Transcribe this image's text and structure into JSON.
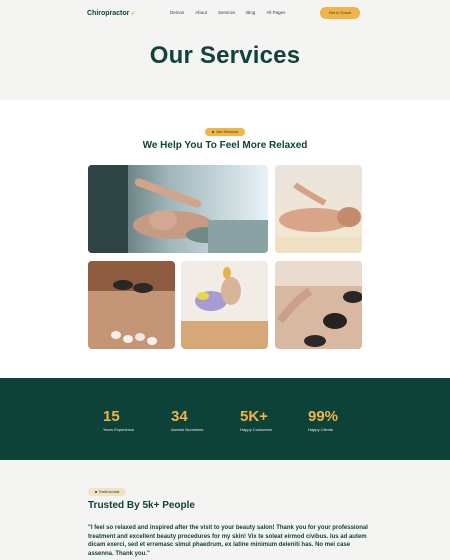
{
  "header": {
    "logo": "Chiropractor",
    "nav": [
      "Demos",
      "About",
      "Services",
      "Blog",
      "All Pages"
    ],
    "cta_label": "Get in Touch",
    "page_title": "Our Services"
  },
  "services": {
    "badge": "Our Services",
    "title": "We Help You To Feel More Relaxed",
    "photos": [
      "massage-photo",
      "back-massage-photo",
      "hot-stones-photo",
      "oil-massage-photo",
      "stones-back-photo"
    ]
  },
  "stats": [
    {
      "value": "15",
      "label": "Years Experience"
    },
    {
      "value": "34",
      "label": "Awards Nominees"
    },
    {
      "value": "5K+",
      "label": "Happy Customers"
    },
    {
      "value": "99%",
      "label": "Happy Clients"
    }
  ],
  "testimonials": {
    "badge": "Testimonials",
    "title": "Trusted By 5k+ People",
    "quote": "\"I feel so relaxed and inspired after the visit to your beauty salon! Thank you for your professional treatment and excellent beauty procedures for my skin! Vix te soleat eirmod civibus. Ius ad autem dicam exerci, sed et erremasc simul phaedrum, ex latine minimum deleniti has. No mei case assenna. Thank you.\""
  },
  "colors": {
    "brand_green": "#10433b",
    "accent_yellow": "#f2b347",
    "stats_bg": "#0d4238"
  }
}
